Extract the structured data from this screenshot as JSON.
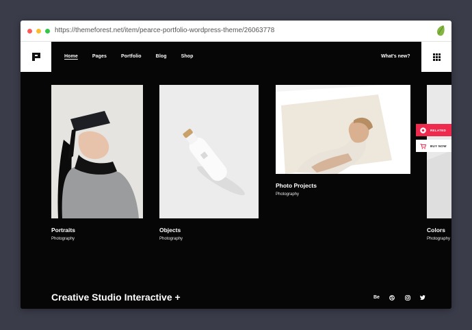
{
  "browser": {
    "url": "https://themeforest.net/item/pearce-portfolio-wordpress-theme/26063778"
  },
  "nav": {
    "items": [
      {
        "label": "Home",
        "active": true
      },
      {
        "label": "Pages",
        "active": false
      },
      {
        "label": "Portfolio",
        "active": false
      },
      {
        "label": "Blog",
        "active": false
      },
      {
        "label": "Shop",
        "active": false
      }
    ],
    "whats_new": "What's new?"
  },
  "portfolio": {
    "items": [
      {
        "title": "Portraits",
        "category": "Photography"
      },
      {
        "title": "Objects",
        "category": "Photography"
      },
      {
        "title": "Photo Projects",
        "category": "Photography"
      },
      {
        "title": "Colors",
        "category": "Photography"
      }
    ]
  },
  "side_buttons": {
    "related": "RELATED",
    "buy_now": "BUY NOW"
  },
  "footer": {
    "title": "Creative Studio Interactive +",
    "social": [
      "Be",
      "dribbble-icon",
      "instagram-icon",
      "twitter-icon"
    ]
  },
  "colors": {
    "background": "#3b3c4a",
    "site_bg": "#060606",
    "accent": "#ee2a4f",
    "envato_green": "#82b541"
  }
}
